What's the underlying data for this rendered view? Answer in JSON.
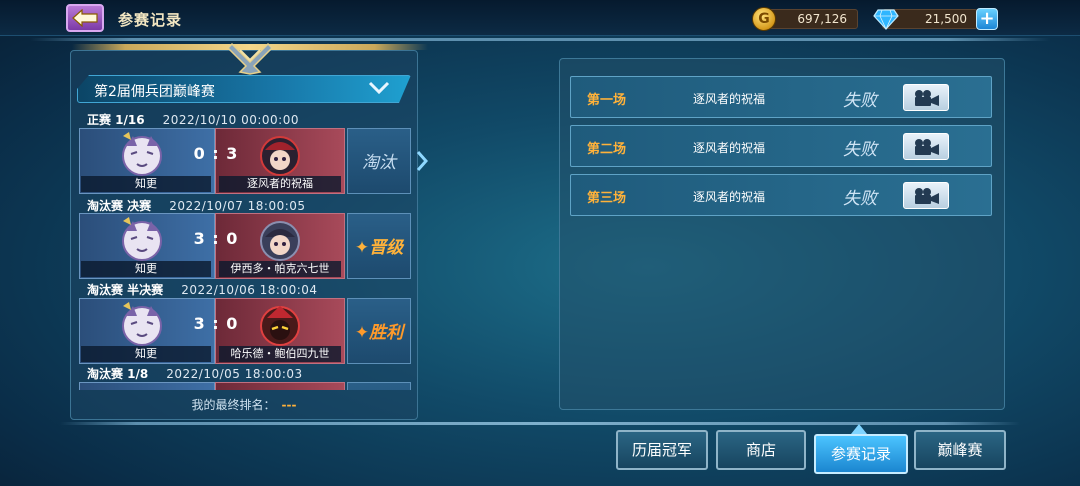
{
  "header": {
    "title": "参赛记录"
  },
  "resources": {
    "gold": "697,126",
    "gems": "21,500"
  },
  "tournament": {
    "name": "第2届佣兵团巅峰赛"
  },
  "matches": [
    {
      "round": "正赛 1/16",
      "datetime": "2022/10/10 00:00:00",
      "score": "0 : 3",
      "player": "知更",
      "opponent": "逐风者的祝福",
      "result": "淘汰"
    },
    {
      "round": "淘汰赛 决赛",
      "datetime": "2022/10/07 18:00:05",
      "score": "3 : 0",
      "player": "知更",
      "opponent": "伊西多・帕克六七世",
      "result": "✦晋级"
    },
    {
      "round": "淘汰赛 半决赛",
      "datetime": "2022/10/06 18:00:04",
      "score": "3 : 0",
      "player": "知更",
      "opponent": "哈乐德・鲍伯四九世",
      "result": "✦胜利"
    },
    {
      "round": "淘汰赛 1/8",
      "datetime": "2022/10/05 18:00:03"
    }
  ],
  "final_rank": {
    "label": "我的最终排名：",
    "value": "---"
  },
  "rounds": [
    {
      "name": "第一场",
      "opponent": "逐风者的祝福",
      "outcome": "失败"
    },
    {
      "name": "第二场",
      "opponent": "逐风者的祝福",
      "outcome": "失败"
    },
    {
      "name": "第三场",
      "opponent": "逐风者的祝福",
      "outcome": "失败"
    }
  ],
  "tabs": [
    {
      "label": "历届冠军"
    },
    {
      "label": "商店"
    },
    {
      "label": "参赛记录"
    },
    {
      "label": "巅峰赛"
    }
  ],
  "colors": {
    "accent": "#ffb23a",
    "active_tab": "#3aa9ec"
  }
}
